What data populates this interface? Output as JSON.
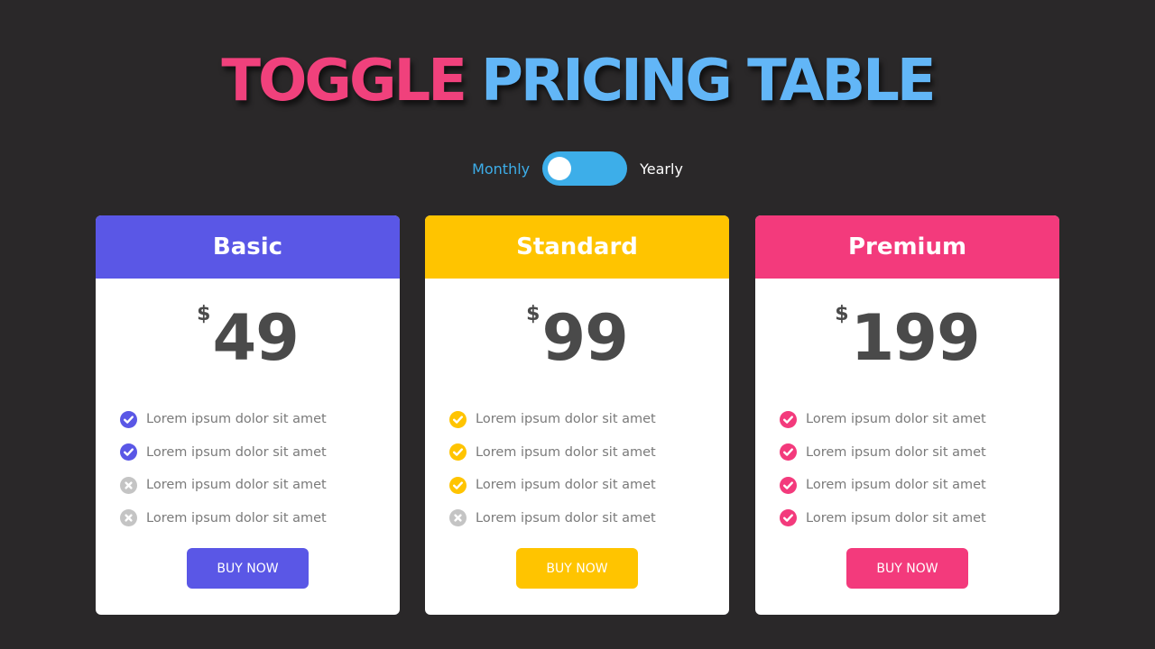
{
  "title": {
    "word1": "TOGGLE",
    "word2": "PRICING TABLE",
    "word1_color": "#f0417c",
    "word2_color": "#62b6f7"
  },
  "toggle": {
    "left_label": "Monthly",
    "right_label": "Yearly",
    "left_color": "#3daee9",
    "right_color": "#ffffff",
    "track_color": "#3daee9",
    "state": "monthly"
  },
  "plans": [
    {
      "name": "Basic",
      "color": "#5a57e6",
      "currency": "$",
      "price": "49",
      "features": [
        {
          "text": "Lorem ipsum dolor sit amet",
          "included": true
        },
        {
          "text": "Lorem ipsum dolor sit amet",
          "included": true
        },
        {
          "text": "Lorem ipsum dolor sit amet",
          "included": false
        },
        {
          "text": "Lorem ipsum dolor sit amet",
          "included": false
        }
      ],
      "button": "BUY NOW"
    },
    {
      "name": "Standard",
      "color": "#ffc400",
      "currency": "$",
      "price": "99",
      "features": [
        {
          "text": "Lorem ipsum dolor sit amet",
          "included": true
        },
        {
          "text": "Lorem ipsum dolor sit amet",
          "included": true
        },
        {
          "text": "Lorem ipsum dolor sit amet",
          "included": true
        },
        {
          "text": "Lorem ipsum dolor sit amet",
          "included": false
        }
      ],
      "button": "BUY NOW"
    },
    {
      "name": "Premium",
      "color": "#f33a7c",
      "currency": "$",
      "price": "199",
      "features": [
        {
          "text": "Lorem ipsum dolor sit amet",
          "included": true
        },
        {
          "text": "Lorem ipsum dolor sit amet",
          "included": true
        },
        {
          "text": "Lorem ipsum dolor sit amet",
          "included": true
        },
        {
          "text": "Lorem ipsum dolor sit amet",
          "included": true
        }
      ],
      "button": "BUY NOW"
    }
  ],
  "icons": {
    "included": "check-circle-icon",
    "excluded": "x-circle-icon",
    "excluded_color": "#c4c4c4"
  }
}
